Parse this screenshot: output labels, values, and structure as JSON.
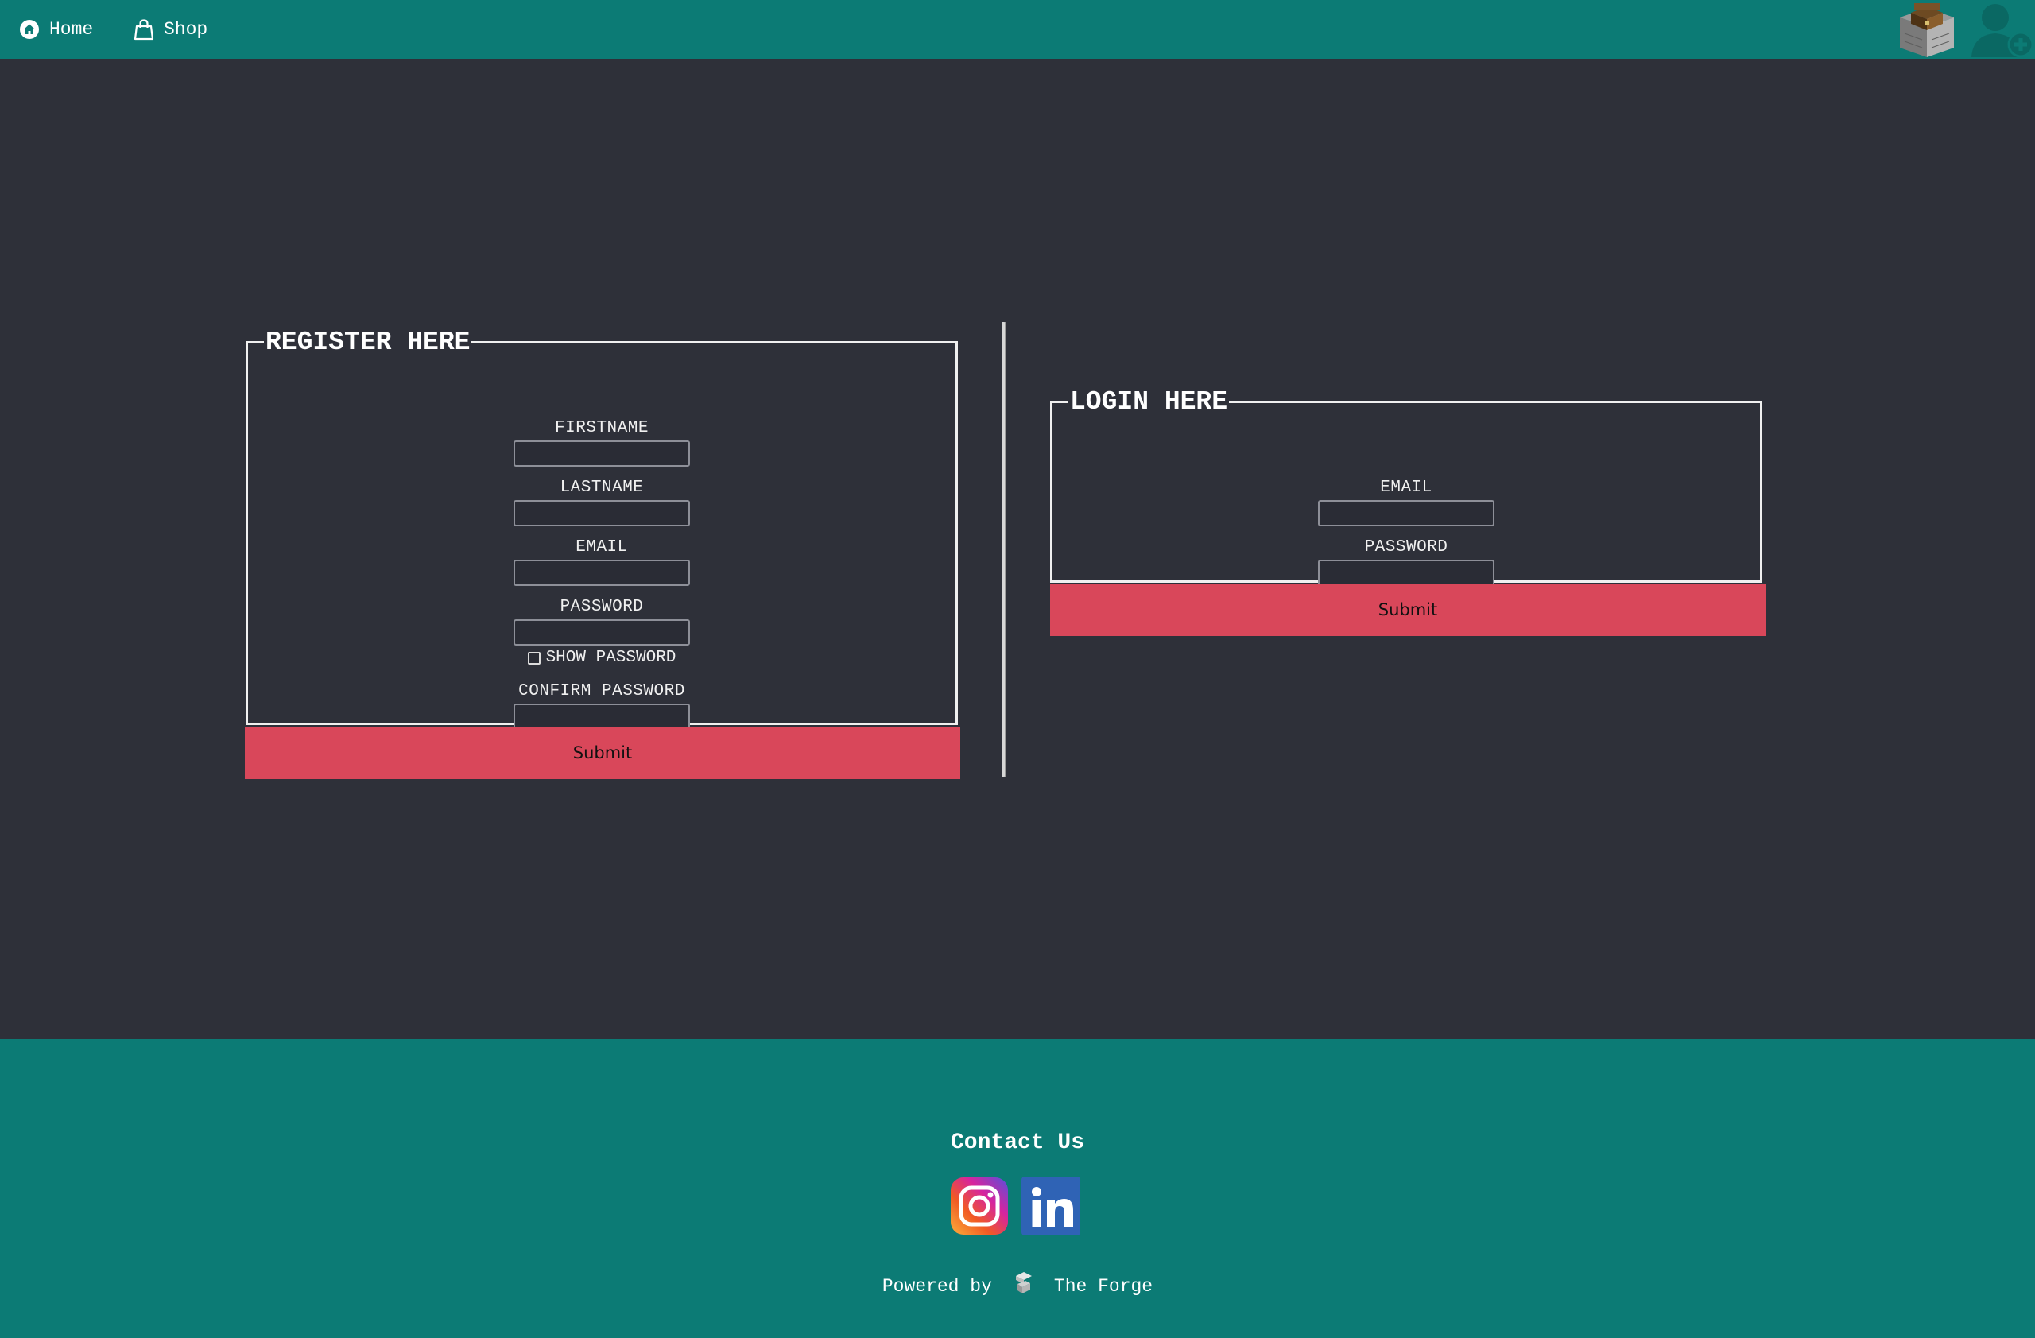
{
  "nav": {
    "home_label": "Home",
    "shop_label": "Shop",
    "home_icon": "home-icon",
    "shop_icon": "shopping-bag-icon",
    "chest_icon": "treasure-chest-icon",
    "add_user_icon": "add-user-icon"
  },
  "register": {
    "legend": "REGISTER HERE",
    "firstname_label": "FIRSTNAME",
    "firstname_value": "",
    "lastname_label": "LASTNAME",
    "lastname_value": "",
    "email_label": "EMAIL",
    "email_value": "",
    "password_label": "PASSWORD",
    "password_value": "",
    "show_password_label": "SHOW PASSWORD",
    "show_password_checked": false,
    "confirm_password_label": "CONFIRM PASSWORD",
    "confirm_password_value": "",
    "submit_label": "Submit"
  },
  "login": {
    "legend": "LOGIN HERE",
    "email_label": "EMAIL",
    "email_value": "",
    "password_label": "PASSWORD",
    "password_value": "",
    "submit_label": "Submit"
  },
  "footer": {
    "contact_title": "Contact Us",
    "social": [
      "instagram-icon",
      "linkedin-icon"
    ],
    "powered_by_label": "Powered by",
    "powered_by_name": "The Forge",
    "forge_icon": "forge-logo-icon"
  },
  "colors": {
    "teal": "#0c7b75",
    "background": "#2e3039",
    "accent_red": "#d9475a"
  }
}
